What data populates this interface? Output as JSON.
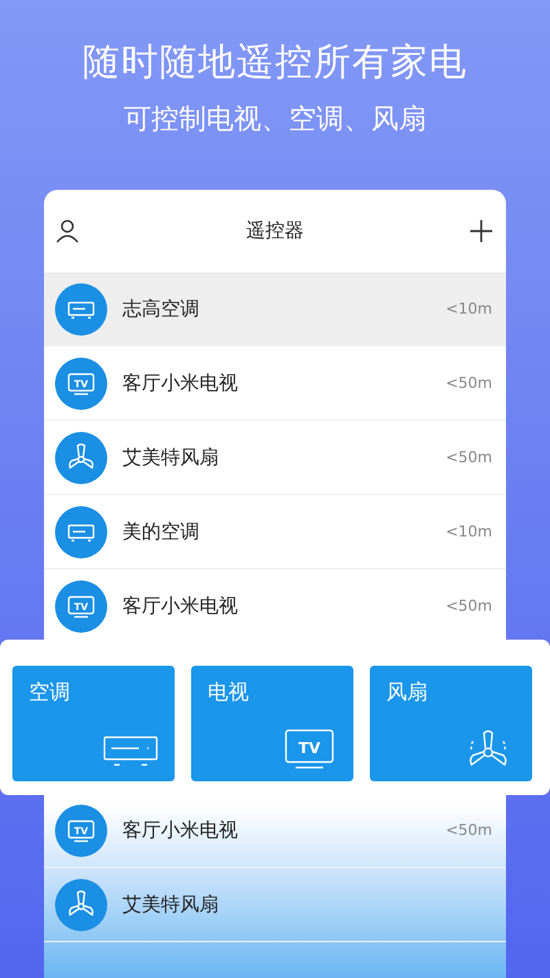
{
  "hero": {
    "title": "随时随地遥控所有家电",
    "subtitle": "可控制电视、空调、风扇"
  },
  "header": {
    "title": "遥控器"
  },
  "devices": [
    {
      "kind": "ac",
      "name": "志高空调",
      "distance": "<10m",
      "selected": true
    },
    {
      "kind": "tv",
      "icon_text": "TV",
      "name": "客厅小米电视",
      "distance": "<50m",
      "selected": false
    },
    {
      "kind": "fan",
      "name": "艾美特风扇",
      "distance": "<50m",
      "selected": false
    },
    {
      "kind": "ac",
      "name": "美的空调",
      "distance": "<10m",
      "selected": false
    },
    {
      "kind": "tv",
      "icon_text": "TV",
      "name": "客厅小米电视",
      "distance": "<50m",
      "selected": false
    }
  ],
  "categories": [
    {
      "kind": "ac",
      "label": "空调"
    },
    {
      "kind": "tv",
      "label": "电视",
      "icon_text": "TV"
    },
    {
      "kind": "fan",
      "label": "风扇"
    }
  ],
  "devices_below": [
    {
      "kind": "tv",
      "icon_text": "TV",
      "name": "客厅小米电视",
      "distance": "<50m",
      "selected": false
    },
    {
      "kind": "fan",
      "name": "艾美特风扇",
      "selected": false
    }
  ]
}
